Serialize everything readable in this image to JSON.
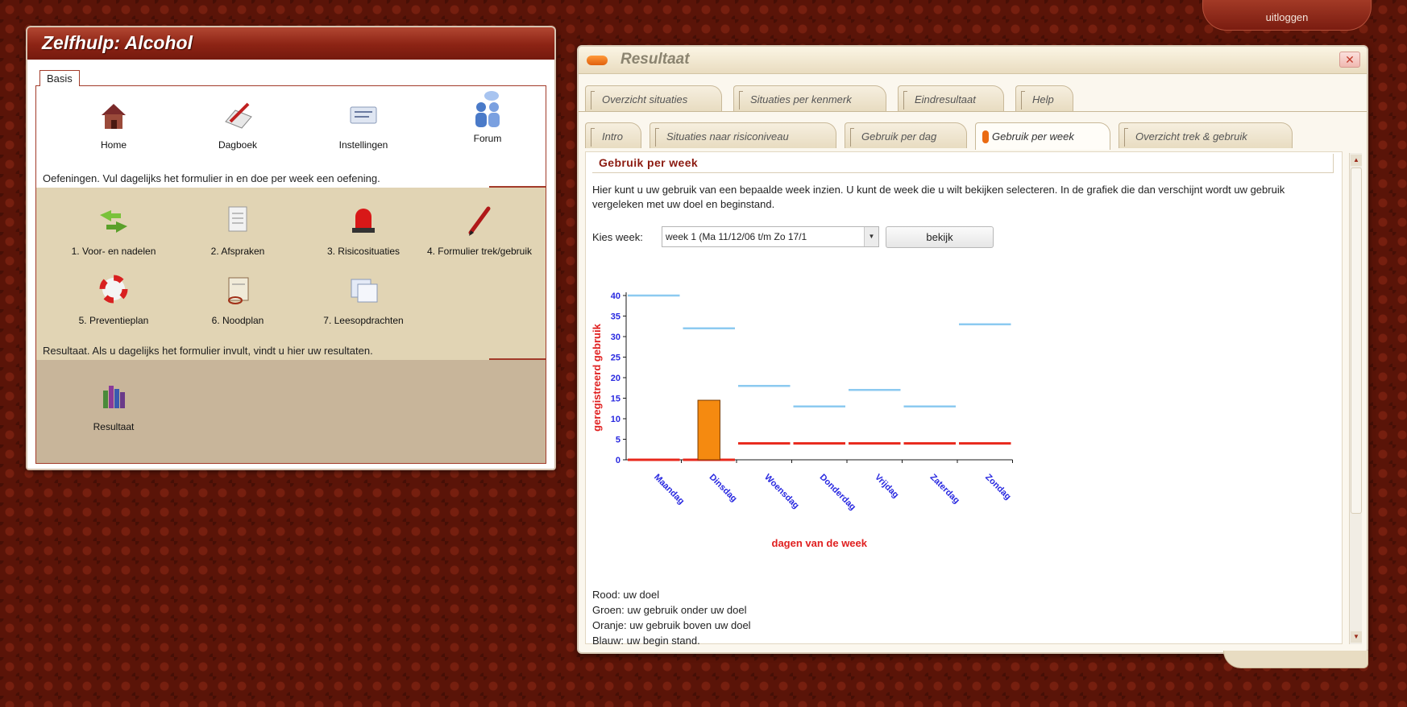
{
  "header": {
    "logout_label": "uitloggen"
  },
  "left_panel": {
    "title": "Zelfhulp: Alcohol",
    "basis": {
      "label": "Basis",
      "items": [
        {
          "label": "Home",
          "icon": "house-icon"
        },
        {
          "label": "Dagboek",
          "icon": "diary-pen-icon"
        },
        {
          "label": "Instellingen",
          "icon": "settings-icon"
        },
        {
          "label": "Forum",
          "icon": "forum-people-icon"
        }
      ]
    },
    "oefeningen": {
      "heading": "Oefeningen. Vul dagelijks het formulier in en doe per week een oefening.",
      "items": [
        {
          "label": "1. Voor- en nadelen",
          "icon": "arrows-icon"
        },
        {
          "label": "2. Afspraken",
          "icon": "checklist-icon"
        },
        {
          "label": "3. Risicosituaties",
          "icon": "siren-icon"
        },
        {
          "label": "4. Formulier trek/gebruik",
          "icon": "pen-icon"
        },
        {
          "label": "5. Preventieplan",
          "icon": "lifebuoy-icon"
        },
        {
          "label": "6. Noodplan",
          "icon": "clipboard-icon"
        },
        {
          "label": "7. Leesopdrachten",
          "icon": "documents-icon"
        }
      ]
    },
    "resultaat": {
      "heading": "Resultaat.  Als u dagelijks het formulier invult, vindt u hier uw resultaten.",
      "items": [
        {
          "label": "Resultaat",
          "icon": "books-chart-icon"
        }
      ]
    }
  },
  "window": {
    "title": "Resultaat",
    "tabs_row1": [
      "Overzicht situaties",
      "Situaties per kenmerk",
      "Eindresultaat",
      "Help"
    ],
    "tabs_row2": [
      "Intro",
      "Situaties naar risiconiveau",
      "Gebruik per dag",
      "Gebruik per week",
      "Overzicht trek & gebruik"
    ],
    "active_tab": "Gebruik per week",
    "content": {
      "heading": "Gebruik per week",
      "intro": "Hier kunt u uw gebruik van een bepaalde week inzien. U kunt de week die u wilt bekijken selecteren. In de grafiek die dan verschijnt wordt uw gebruik vergeleken met uw doel en beginstand.",
      "kies_label": "Kies week:",
      "week_value": "week 1 (Ma 11/12/06 t/m Zo 17/1",
      "button_label": "bekijk",
      "legend": [
        "Rood: uw doel",
        "Groen: uw gebruik onder uw doel",
        "Oranje: uw gebruik boven uw doel",
        "Blauw: uw begin stand."
      ]
    }
  },
  "chart_data": {
    "type": "bar",
    "categories": [
      "Maandag",
      "Dinsdag",
      "Woensdag",
      "Donderdag",
      "Vrijdag",
      "Zaterdag",
      "Zondag"
    ],
    "series": [
      {
        "name": "Rood: uw doel",
        "kind": "line",
        "color": "#e8281c",
        "values": [
          0,
          0,
          4,
          4,
          4,
          4,
          4
        ]
      },
      {
        "name": "Oranje: uw gebruik boven uw doel",
        "kind": "bar",
        "color": "#f58a10",
        "values": [
          0,
          14.5,
          0,
          0,
          0,
          0,
          0
        ]
      },
      {
        "name": "Blauw: uw begin stand.",
        "kind": "line",
        "color": "#8ccaf0",
        "values": [
          40,
          32,
          18,
          13,
          17,
          13,
          33
        ]
      }
    ],
    "xlabel": "dagen van de week",
    "ylabel": "geregistreerd gebruik",
    "yticks": [
      0,
      5,
      10,
      15,
      20,
      25,
      30,
      35,
      40
    ],
    "ylim": [
      0,
      40
    ],
    "grid": false
  }
}
